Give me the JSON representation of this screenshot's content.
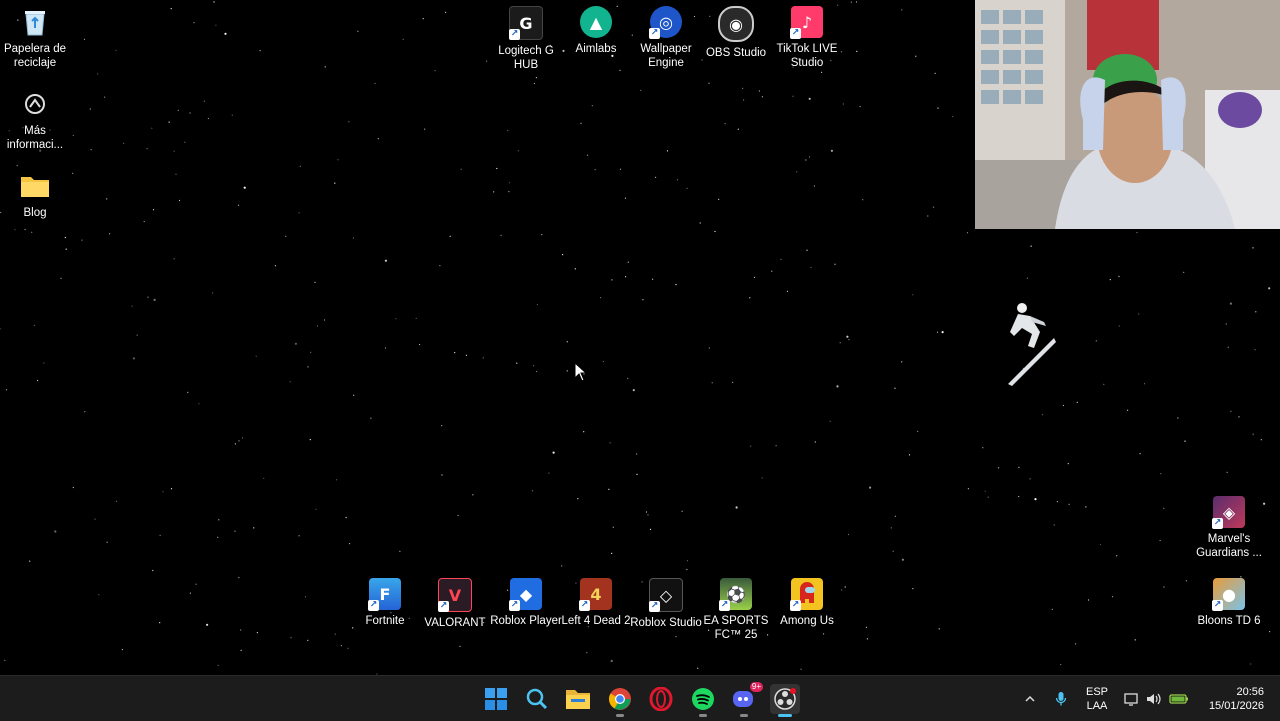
{
  "desktop": {
    "left_icons": [
      {
        "label": "Papelera de reciclaje",
        "icon": "recycle-bin-icon"
      },
      {
        "label": "Más informaci...",
        "icon": "info-icon"
      },
      {
        "label": "Blog",
        "icon": "folder-icon"
      }
    ],
    "top_icons": [
      {
        "label": "Logitech G HUB",
        "icon": "logitech-icon"
      },
      {
        "label": "Aimlabs",
        "icon": "aimlabs-icon"
      },
      {
        "label": "Wallpaper Engine",
        "icon": "wallpaper-engine-icon"
      },
      {
        "label": "OBS Studio",
        "icon": "obs-icon"
      },
      {
        "label": "TikTok LIVE Studio",
        "icon": "tiktok-icon"
      }
    ],
    "right_icons": [
      {
        "label": "Marvel's Guardians ...",
        "icon": "guardians-icon"
      },
      {
        "label": "Bloons TD 6",
        "icon": "bloons-icon"
      }
    ],
    "bottom_icons": [
      {
        "label": "Fortnite",
        "icon": "fortnite-icon"
      },
      {
        "label": "VALORANT",
        "icon": "valorant-icon"
      },
      {
        "label": "Roblox Player",
        "icon": "roblox-icon"
      },
      {
        "label": "Left 4 Dead 2",
        "icon": "l4d2-icon"
      },
      {
        "label": "Roblox Studio",
        "icon": "roblox-studio-icon"
      },
      {
        "label": "EA SPORTS FC™ 25",
        "icon": "ea-fc-icon"
      },
      {
        "label": "Among Us",
        "icon": "among-us-icon"
      }
    ]
  },
  "taskbar": {
    "apps": [
      "start-icon",
      "search-icon",
      "file-explorer-icon",
      "chrome-icon",
      "opera-icon",
      "spotify-icon",
      "discord-icon",
      "obs-icon"
    ],
    "discord_badge": "9+",
    "tray": {
      "lang_line1": "ESP",
      "lang_line2": "LAA",
      "time": "20:56",
      "date": "15/01/2026"
    }
  },
  "colors": {
    "desktop_bg": "#000000",
    "taskbar_bg": "#1c1c1c",
    "accent": "#0078d4"
  }
}
